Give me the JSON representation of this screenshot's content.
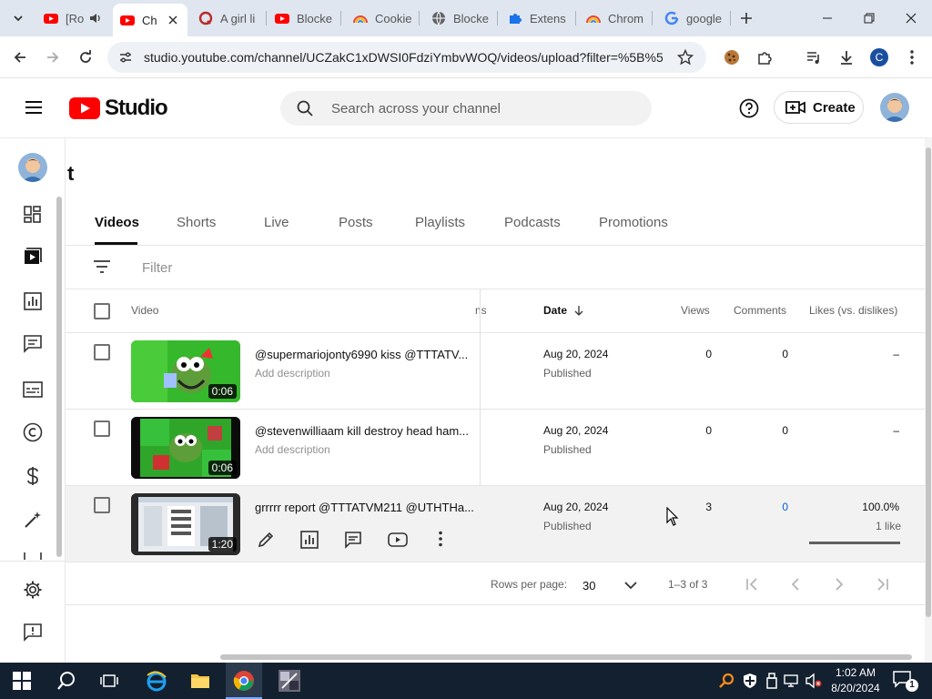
{
  "browser": {
    "tabs": [
      {
        "title": "[Ro",
        "favicon": "youtube-icon",
        "audio": true
      },
      {
        "title": "Ch",
        "favicon": "youtube-icon",
        "active": true
      },
      {
        "title": "A girl li",
        "favicon": "quora-icon"
      },
      {
        "title": "Blocke",
        "favicon": "youtube-icon"
      },
      {
        "title": "Cookie",
        "favicon": "rainbow-icon"
      },
      {
        "title": "Blocke",
        "favicon": "globe-icon"
      },
      {
        "title": "Extens",
        "favicon": "puzzle-icon"
      },
      {
        "title": "Chrom",
        "favicon": "rainbow-icon"
      },
      {
        "title": "google",
        "favicon": "google-icon"
      }
    ],
    "url": "studio.youtube.com/channel/UCZakC1xDWSI0FdziYmbvWOQ/videos/upload?filter=%5B%5...",
    "profile_initial": "C"
  },
  "studio": {
    "logo_text": "Studio",
    "search_placeholder": "Search across your channel",
    "create_label": "Create",
    "page_title_fragment": "t",
    "tabs": [
      "Videos",
      "Shorts",
      "Live",
      "Posts",
      "Playlists",
      "Podcasts",
      "Promotions"
    ],
    "filter_placeholder": "Filter",
    "columns": {
      "video": "Video",
      "hidden_fragment": "ns",
      "date": "Date",
      "views": "Views",
      "comments": "Comments",
      "likes": "Likes (vs. dislikes)"
    },
    "rows": [
      {
        "title": "@supermariojonty6990 kiss @TTTATV...",
        "description": "Add description",
        "duration": "0:06",
        "date": "Aug 20, 2024",
        "status": "Published",
        "views": "0",
        "comments": "0",
        "likes": "–"
      },
      {
        "title": "@stevenwilliaam kill destroy head ham...",
        "description": "Add description",
        "duration": "0:06",
        "date": "Aug 20, 2024",
        "status": "Published",
        "views": "0",
        "comments": "0",
        "likes": "–"
      },
      {
        "title": "grrrrr report @TTTATVM211 @UTHTHa...",
        "description": "",
        "duration": "1:20",
        "date": "Aug 20, 2024",
        "status": "Published",
        "views": "3",
        "comments": "0",
        "likes": "100.0%",
        "likes_sub": "1 like",
        "likes_ratio": 1.0
      }
    ],
    "pagination": {
      "rows_per_page_label": "Rows per page:",
      "rows_per_page": "30",
      "range": "1–3 of 3"
    }
  },
  "taskbar": {
    "time": "1:02 AM",
    "date": "8/20/2024",
    "notification_count": "1"
  },
  "colors": {
    "youtube_red": "#ff0000",
    "accent_blue": "#065fd4",
    "taskbar": "#13202f",
    "tabstrip": "#dfe6f0"
  }
}
